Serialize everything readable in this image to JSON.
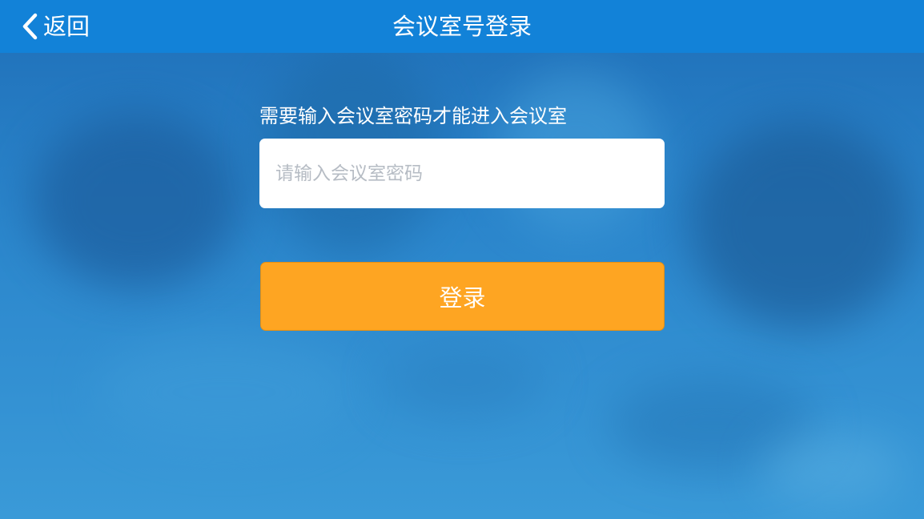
{
  "header": {
    "back_label": "返回",
    "title": "会议室号登录",
    "back_icon": "chevron-left-icon"
  },
  "form": {
    "hint": "需要输入会议室密码才能进入会议室",
    "password_placeholder": "请输入会议室密码",
    "password_value": "",
    "login_label": "登录"
  },
  "colors": {
    "header_bg": "#1282d8",
    "background": "#2b86cc",
    "login_button": "#fea522",
    "text": "#ffffff",
    "placeholder": "#b6bcc4"
  }
}
